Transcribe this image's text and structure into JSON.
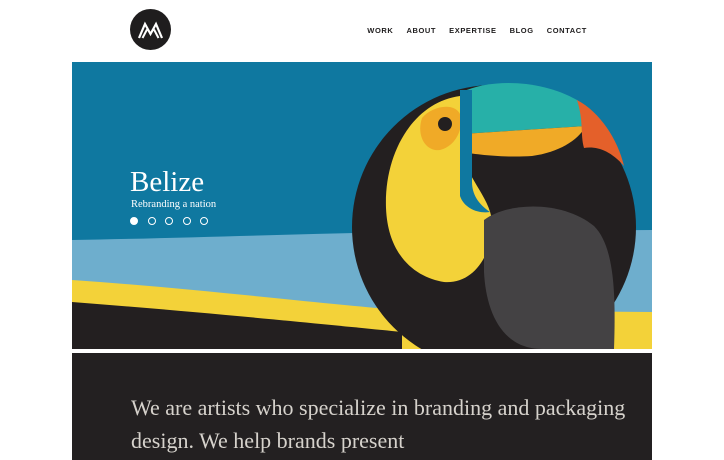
{
  "header": {
    "logo_icon": "mountain-logo-icon",
    "nav": [
      {
        "label": "WORK"
      },
      {
        "label": "ABOUT"
      },
      {
        "label": "EXPERTISE"
      },
      {
        "label": "BLOG"
      },
      {
        "label": "CONTACT"
      }
    ]
  },
  "hero": {
    "title": "Belize",
    "subtitle": "Rebranding a nation",
    "slide_count": 5,
    "active_slide": 1,
    "illustration_icon": "toucan-illustration",
    "colors": {
      "sky": "#0f78a0",
      "light_blue": "#6eaecd",
      "yellow": "#f3d239",
      "black": "#231f20",
      "teal": "#27b0a8",
      "orange": "#f0aa27",
      "beak_tip": "#e4602a"
    }
  },
  "about": {
    "text": "We are artists who specialize in branding and packaging design. We help brands present"
  }
}
